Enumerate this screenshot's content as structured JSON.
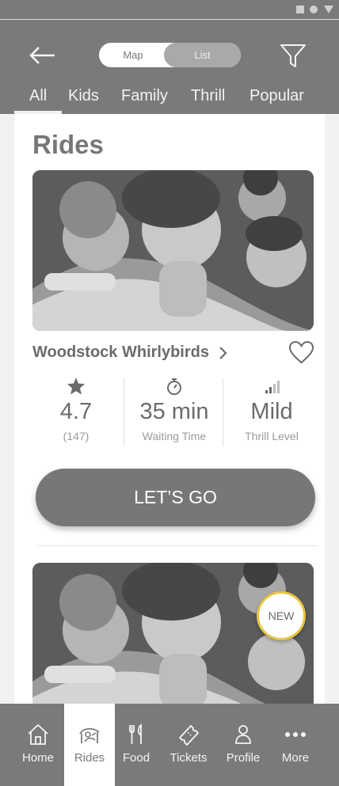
{
  "header": {
    "toggle": {
      "map_label": "Map",
      "list_label": "List",
      "selected": "List"
    },
    "tabs": [
      {
        "label": "All",
        "active": true
      },
      {
        "label": "Kids",
        "active": false
      },
      {
        "label": "Family",
        "active": false
      },
      {
        "label": "Thrill",
        "active": false
      },
      {
        "label": "Popular",
        "active": false
      }
    ]
  },
  "main": {
    "section_title": "Rides",
    "rides": [
      {
        "name": "Woodstock Whirlybirds",
        "rating": "4.7",
        "rating_count": "(147)",
        "wait_time": "35 min",
        "wait_label": "Waiting Time",
        "thrill_level": "Mild",
        "thrill_label": "Thrill Level",
        "cta_label": "LET’S GO"
      },
      {
        "badge": "NEW"
      }
    ]
  },
  "bottom_nav": {
    "items": [
      {
        "label": "Home",
        "icon": "home-icon"
      },
      {
        "label": "Rides",
        "icon": "ride-icon",
        "active": true
      },
      {
        "label": "Food",
        "icon": "fork-knife-icon"
      },
      {
        "label": "Tickets",
        "icon": "ticket-icon"
      },
      {
        "label": "Profile",
        "icon": "person-icon"
      },
      {
        "label": "More",
        "icon": "more-dots-icon"
      }
    ]
  },
  "colors": {
    "header_bg": "#7a7a7a",
    "button_bg": "#777777",
    "badge_ring": "#e8c440",
    "content_bg": "#ffffff"
  }
}
